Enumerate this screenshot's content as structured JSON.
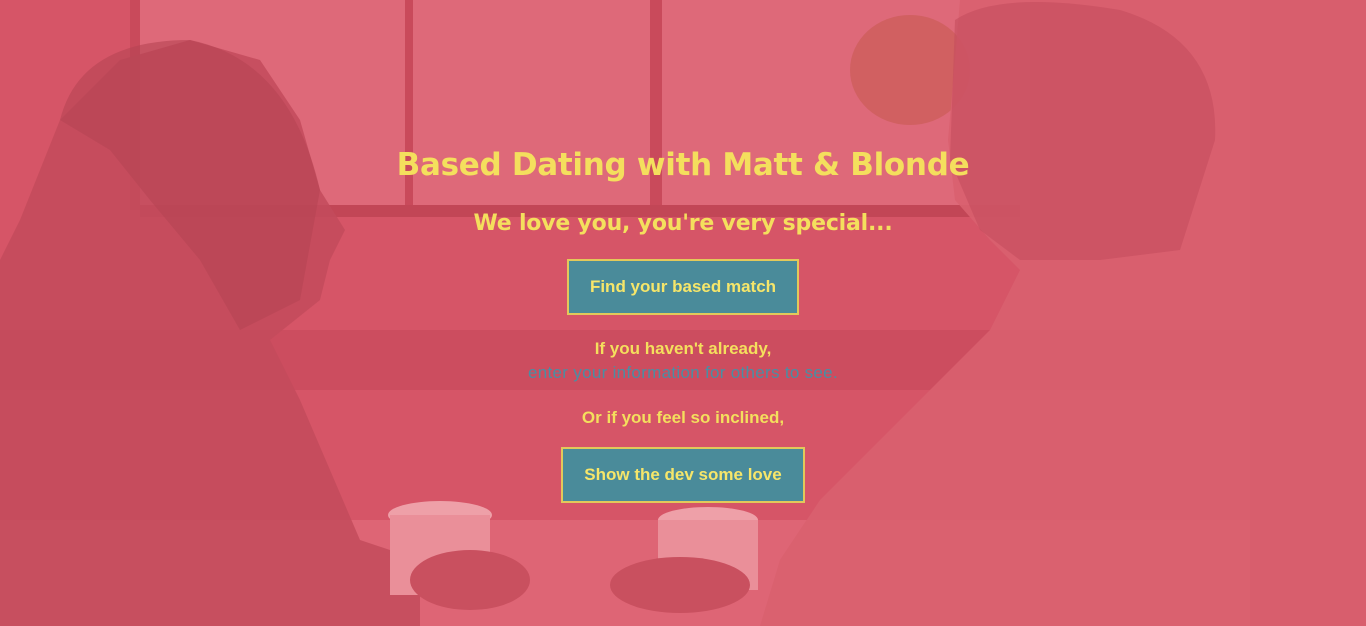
{
  "page": {
    "title": "Based Dating with Matt & Blonde",
    "subtitle": "We love you, you're very special..."
  },
  "actions": {
    "find_match_label": "Find your based match",
    "line_before_link": "If you haven't already,",
    "info_link_text": "enter your information for others to see.",
    "line_before_love": "Or if you feel so inclined,",
    "dev_love_label": "Show the dev some love"
  },
  "colors": {
    "background_overlay": "#d34f60",
    "heading_text": "#f4df5d",
    "button_fill": "#4a8b9a",
    "button_border": "#e2c95a",
    "link_text": "#4a8ea3"
  },
  "background": {
    "image_subject": "couple-with-coffee-photo"
  }
}
